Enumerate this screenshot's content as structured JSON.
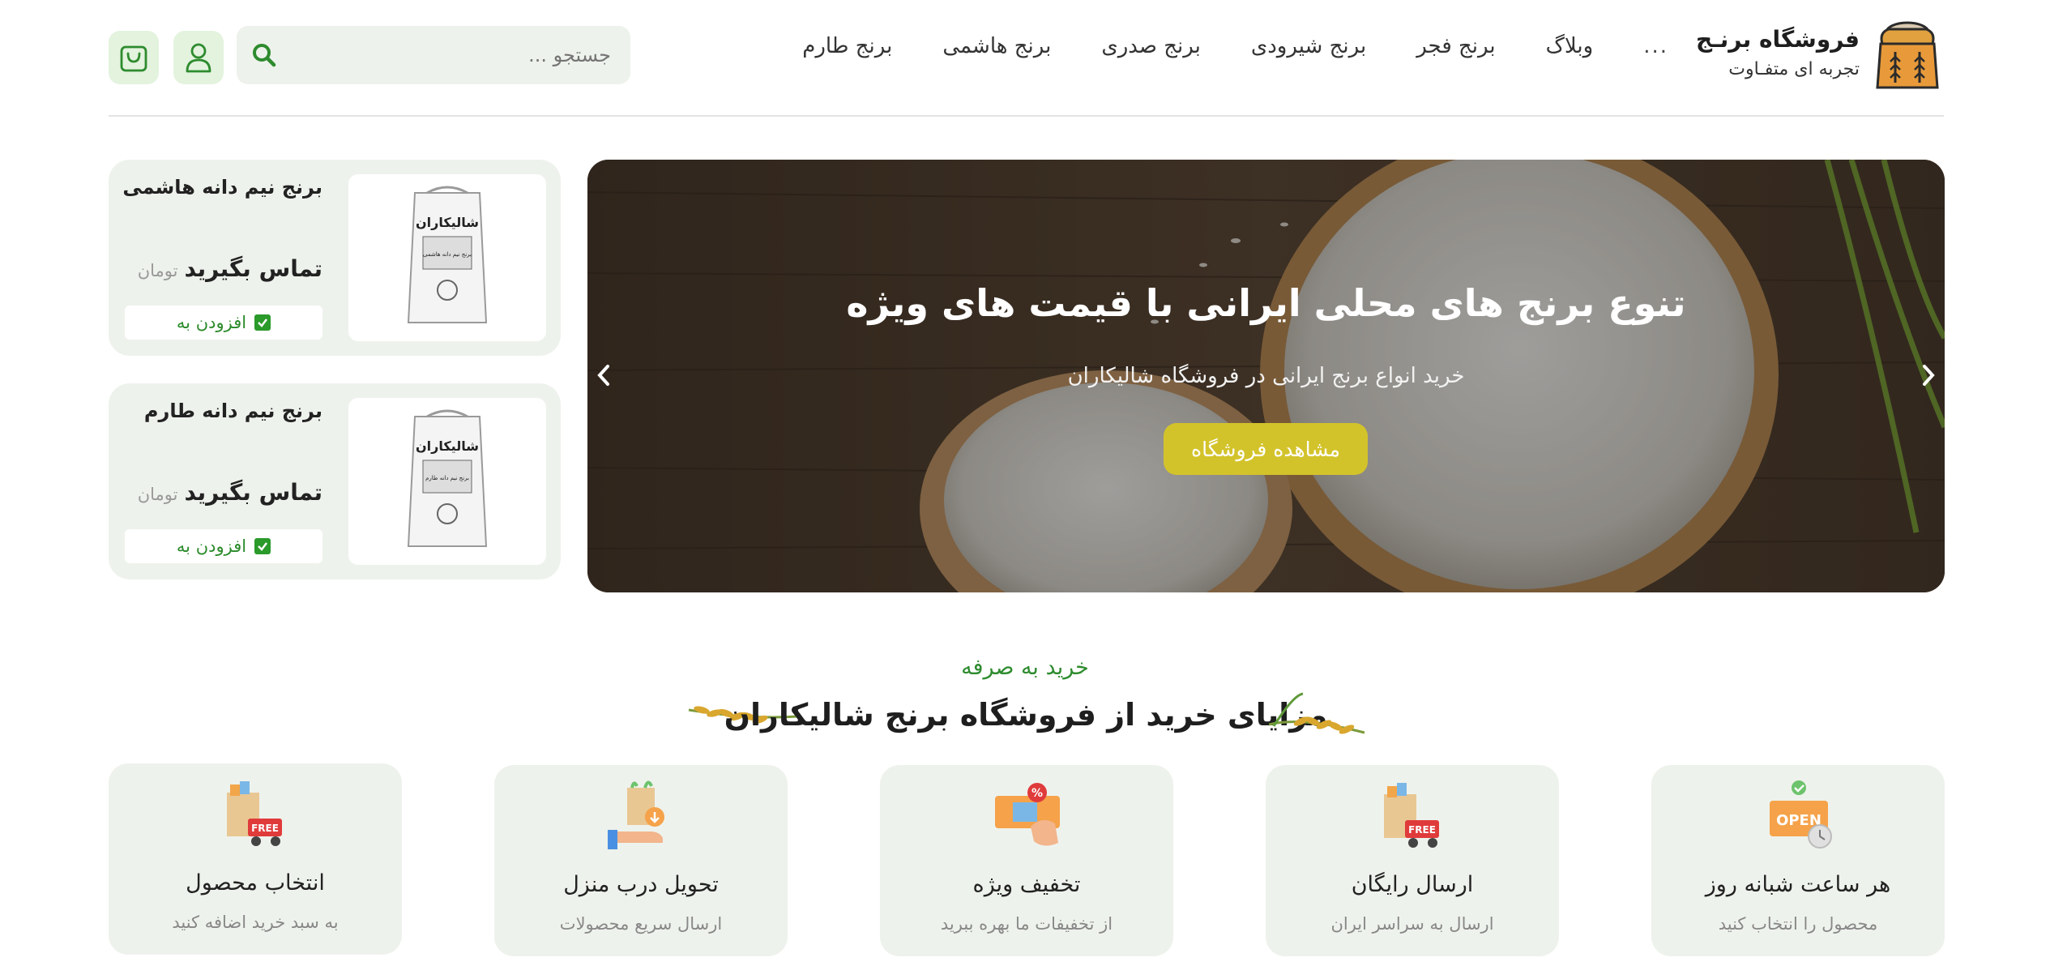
{
  "brand": {
    "title": "فروشگاه برنـج",
    "subtitle": "تجربه ای متفـاوت"
  },
  "nav": {
    "items": [
      "برنج طارم",
      "برنج هاشمی",
      "برنج صدری",
      "برنج شیرودی",
      "برنج فجر",
      "وبلاگ"
    ],
    "more": "..."
  },
  "search": {
    "placeholder": "جستجو ..."
  },
  "icons": {
    "search": "search-icon",
    "user": "user-icon",
    "cart": "shopping-bag-icon"
  },
  "slider": {
    "title": "تنوع برنج های محلی ایرانی با قیمت های ویژه",
    "subtitle": "خرید انواع برنج ایرانی در فروشگاه شالیکاران",
    "button": "مشاهده فروشگاه"
  },
  "products": [
    {
      "title": "برنج نیم دانه هاشمی",
      "price": "تماس بگیرید",
      "unit": "تومان",
      "add": "افزودن به",
      "bag_brand": "شالیکاران",
      "bag_label": "برنج نیم دانه هاشمی"
    },
    {
      "title": "برنج نیم دانه طارم",
      "price": "تماس بگیرید",
      "unit": "تومان",
      "add": "افزودن به",
      "bag_brand": "شالیکاران",
      "bag_label": "برنج نیم دانه طارم"
    }
  ],
  "benefits_section": {
    "subtitle": "خرید به صرفه",
    "title": "مزایای خرید از فروشگاه برنج شالیکاران"
  },
  "benefits": [
    {
      "title": "هر ساعت شبانه روز",
      "desc": "محصول را انتخاب کنید",
      "icon": "open-sign-icon",
      "badge": "OPEN"
    },
    {
      "title": "ارسال رایگان",
      "desc": "ارسال به سراسر ایران",
      "icon": "free-delivery-icon",
      "badge": "FREE"
    },
    {
      "title": "تخفیف ویژه",
      "desc": "از تخفیفات ما بهره ببرید",
      "icon": "discount-ticket-icon",
      "badge": "%"
    },
    {
      "title": "تحویل درب منزل",
      "desc": "ارسال سریع محصولات",
      "icon": "home-delivery-icon"
    },
    {
      "title": "انتخاب محصول",
      "desc": "به سبد خرید اضافه کنید",
      "icon": "product-delivery-icon",
      "badge": "FREE"
    }
  ],
  "colors": {
    "accent_green": "#2e8b2e",
    "card_bg": "#eef2ec",
    "button_yellow": "#d3c32b",
    "icon_btn_bg": "#e3f3de"
  }
}
